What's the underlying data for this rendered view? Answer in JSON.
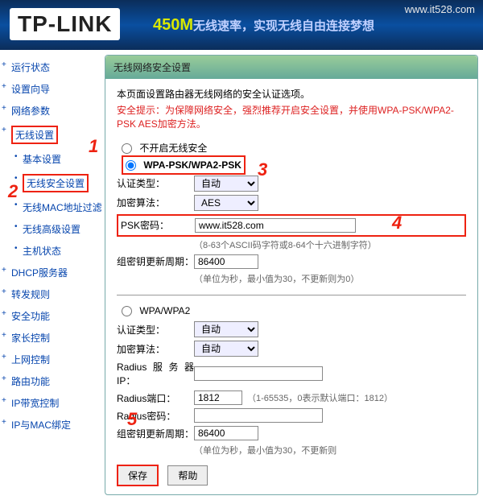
{
  "header": {
    "logo": "TP-LINK",
    "slogan_prefix": "450M",
    "slogan_rest": "无线速率，实现无线自由连接梦想",
    "watermark_url": "www.it528.com"
  },
  "sidebar": {
    "items": [
      {
        "label": "运行状态",
        "sub": false
      },
      {
        "label": "设置向导",
        "sub": false
      },
      {
        "label": "网络参数",
        "sub": false
      },
      {
        "label": "无线设置",
        "sub": false,
        "hl": true
      },
      {
        "label": "基本设置",
        "sub": true
      },
      {
        "label": "无线安全设置",
        "sub": true,
        "hl": true
      },
      {
        "label": "无线MAC地址过滤",
        "sub": true
      },
      {
        "label": "无线高级设置",
        "sub": true
      },
      {
        "label": "主机状态",
        "sub": true
      },
      {
        "label": "DHCP服务器",
        "sub": false
      },
      {
        "label": "转发规则",
        "sub": false
      },
      {
        "label": "安全功能",
        "sub": false
      },
      {
        "label": "家长控制",
        "sub": false
      },
      {
        "label": "上网控制",
        "sub": false
      },
      {
        "label": "路由功能",
        "sub": false
      },
      {
        "label": "IP带宽控制",
        "sub": false
      },
      {
        "label": "IP与MAC绑定",
        "sub": false
      }
    ]
  },
  "main": {
    "title": "无线网络安全设置",
    "desc": "本页面设置路由器无线网络的安全认证选项。",
    "warning": "安全提示：为保障网络安全，强烈推荐开启安全设置，并使用WPA-PSK/WPA2-PSK AES加密方法。",
    "opt_disable": "不开启无线安全",
    "section1": {
      "radio_label": "WPA-PSK/WPA2-PSK",
      "auth_label": "认证类型：",
      "auth_value": "自动",
      "enc_label": "加密算法：",
      "enc_value": "AES",
      "psk_label": "PSK密码：",
      "psk_value": "www.it528.com",
      "psk_hint": "（8-63个ASCII码字符或8-64个十六进制字符）",
      "gkey_label": "组密钥更新周期：",
      "gkey_value": "86400",
      "gkey_hint": "（单位为秒，最小值为30，不更新则为0）"
    },
    "section2": {
      "radio_label": "WPA/WPA2",
      "auth_label": "认证类型：",
      "auth_value": "自动",
      "enc_label": "加密算法：",
      "enc_value": "自动",
      "radius_ip_label": "Radius服务器IP：",
      "radius_ip_value": "",
      "radius_port_label": "Radius端口：",
      "radius_port_value": "1812",
      "radius_port_hint": "（1-65535，0表示默认端口：1812）",
      "radius_pwd_label": "Radius密码：",
      "radius_pwd_value": "",
      "gkey_label": "组密钥更新周期：",
      "gkey_value": "86400",
      "gkey_hint": "（单位为秒，最小值为30，不更新则"
    },
    "buttons": {
      "save": "保存",
      "help": "帮助"
    }
  },
  "callouts": {
    "1": "1",
    "2": "2",
    "3": "3",
    "4": "4",
    "5": "5"
  }
}
